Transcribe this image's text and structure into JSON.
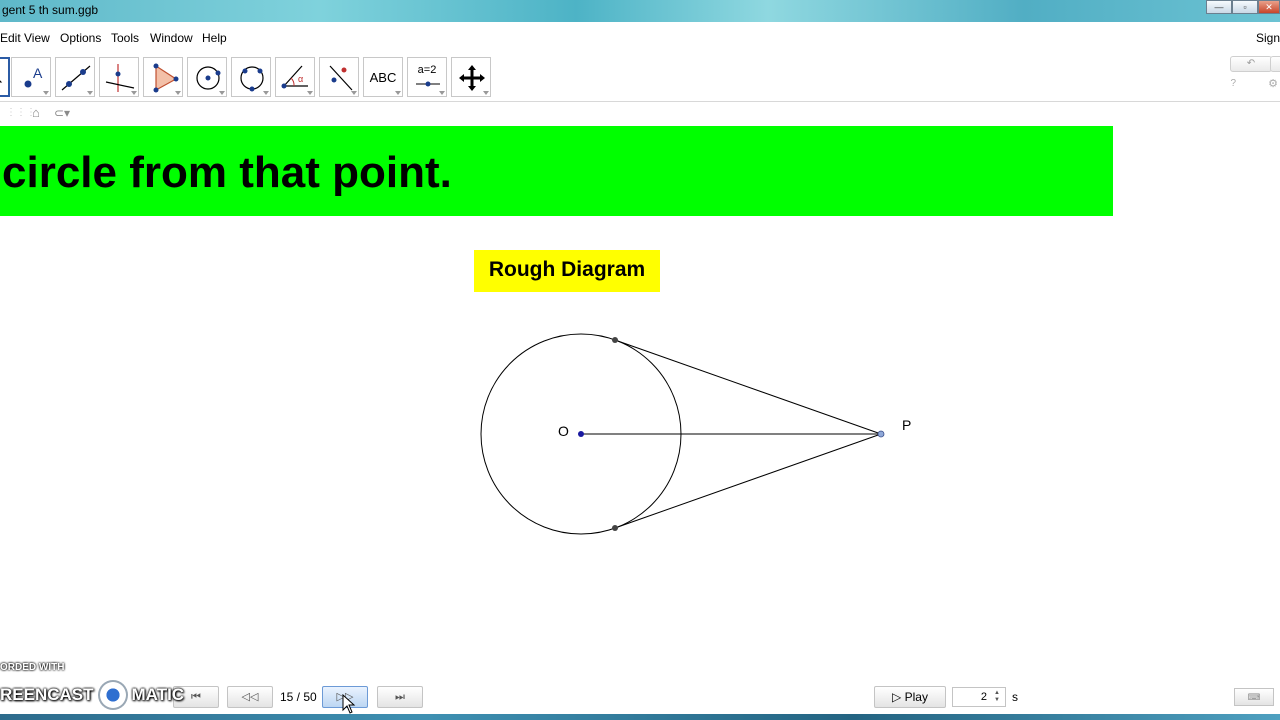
{
  "window": {
    "title": "gent 5 th sum.ggb",
    "minimize_label": "—",
    "maximize_label": "▫",
    "close_label": "✕"
  },
  "menu": {
    "items": [
      "Edit",
      "View",
      "Options",
      "Tools",
      "Window",
      "Help"
    ],
    "sign_in": "Sign"
  },
  "toolbar": {
    "tools": [
      {
        "name": "move-tool",
        "label": ""
      },
      {
        "name": "point-tool",
        "label": ""
      },
      {
        "name": "line-tool",
        "label": ""
      },
      {
        "name": "perpendicular-tool",
        "label": ""
      },
      {
        "name": "polygon-tool",
        "label": ""
      },
      {
        "name": "circle-center-tool",
        "label": ""
      },
      {
        "name": "circle-three-points-tool",
        "label": ""
      },
      {
        "name": "angle-tool",
        "label": ""
      },
      {
        "name": "reflect-tool",
        "label": ""
      },
      {
        "name": "text-tool",
        "label": "ABC"
      },
      {
        "name": "slider-tool",
        "label": "a=2"
      },
      {
        "name": "move-graphics-tool",
        "label": ""
      }
    ],
    "undo_label": "↶",
    "redo_label": "↷"
  },
  "canvas": {
    "banner_text": "circle from that point.",
    "banner_color": "#00ff00",
    "diagram_label": "Rough Diagram",
    "label_color": "#ffff00",
    "point_o": "O",
    "point_p": "P"
  },
  "navigation": {
    "current_page": 15,
    "total_pages": 50,
    "page_text": "15 / 50",
    "play_label": "Play",
    "speed_value": "2",
    "speed_unit": "s"
  },
  "watermark": {
    "top_text": "ORDED WITH",
    "left_text": "REENCAST",
    "right_text": "MATIC"
  }
}
